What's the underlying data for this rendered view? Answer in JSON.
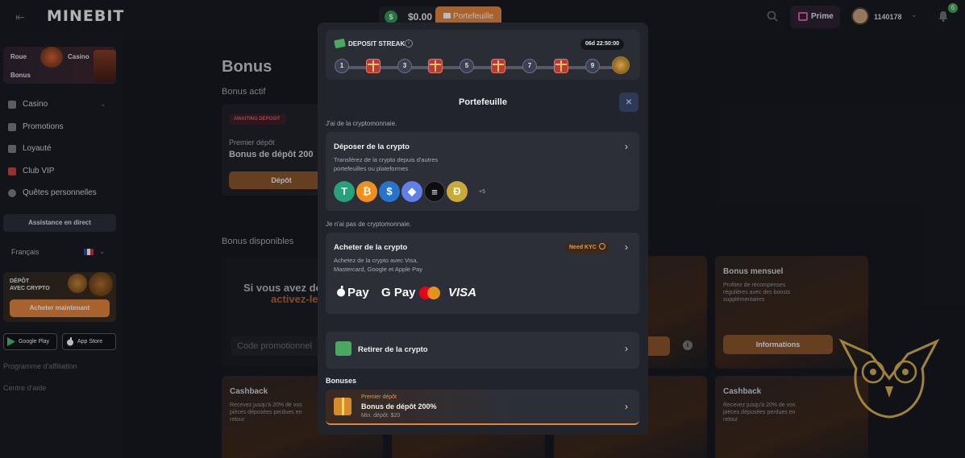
{
  "header": {
    "logo": "MINEBIT",
    "balance": "$0.00",
    "wallet_label": "Portefeuille",
    "prime_label": "Prime",
    "username": "1140178",
    "notif_count": "6"
  },
  "sidebar": {
    "tiles": [
      "Roue",
      "Casino",
      "Bonus"
    ],
    "nav": [
      "Casino",
      "Promotions",
      "Loyauté",
      "Club VIP",
      "Quêtes personnelles"
    ],
    "live_support": "Assistance en direct",
    "language": "Français",
    "crypto_card": {
      "line1": "DÉPÔT",
      "line2": "AVEC CRYPTO",
      "button": "Acheter maintenant"
    },
    "stores": [
      "Google Play",
      "App Store"
    ],
    "links": [
      "Programme d'affiliation",
      "Centre d'aide"
    ]
  },
  "main": {
    "title": "Bonus",
    "active_section": "Bonus actif",
    "active_card": {
      "badge": "AWAITING DEPOSIT",
      "line1": "Premier dépôt",
      "line2": "Bonus de dépôt 200",
      "button": "Dépôt"
    },
    "available_section": "Bonus disponibles",
    "promo_card": {
      "line1": "Si vous avez de",
      "line2": "activez-le",
      "input_placeholder": "Code promotionnel"
    },
    "cards": [
      {
        "title": "Bonus mensuel",
        "desc": "Profitez de récompenses régulières avec des boosts supplémentaires",
        "button": "Informations"
      },
      {
        "title": "Cashback",
        "desc": "Recevez jusqu'à 20% de vos pièces déposées perdues en retour"
      },
      {
        "title": "Cashback",
        "desc": "Recevez jusqu'à 20% de vos pièces déposées perdues en retour"
      }
    ]
  },
  "modal": {
    "streak": {
      "title": "DEPOSIT STREAK",
      "timer": "06d 22:50:00",
      "steps": [
        "1",
        "3",
        "5",
        "7",
        "9"
      ]
    },
    "title": "Portefeuille",
    "close_icon": "×",
    "hint_have": "J'ai de la cryptomonnaie.",
    "deposit": {
      "title": "Déposer de la crypto",
      "desc": "Transférez de la crypto depuis d'autres portefeuilles ou plateformes",
      "more": "+5"
    },
    "hint_none": "Je n'ai pas de cryptomonnaie.",
    "buy": {
      "title": "Acheter de la crypto",
      "kyc": "Need KYC",
      "desc": "Achetez de la crypto avec Visa, Mastercard, Google et Apple Pay",
      "pay_apple": "Pay",
      "pay_google": "G Pay",
      "pay_visa": "VISA"
    },
    "withdraw": {
      "title": "Retirer de la crypto"
    },
    "bonuses_label": "Bonuses",
    "bonus_item": {
      "line1": "Premier dépôt",
      "line2": "Bonus de dépôt 200%",
      "line3": "Min. dépôt: $20"
    },
    "chevron": "›"
  },
  "colors": {
    "accent": "#e5843a",
    "background": "#14161c",
    "modal": "#22242b",
    "card": "#2d2f38"
  }
}
